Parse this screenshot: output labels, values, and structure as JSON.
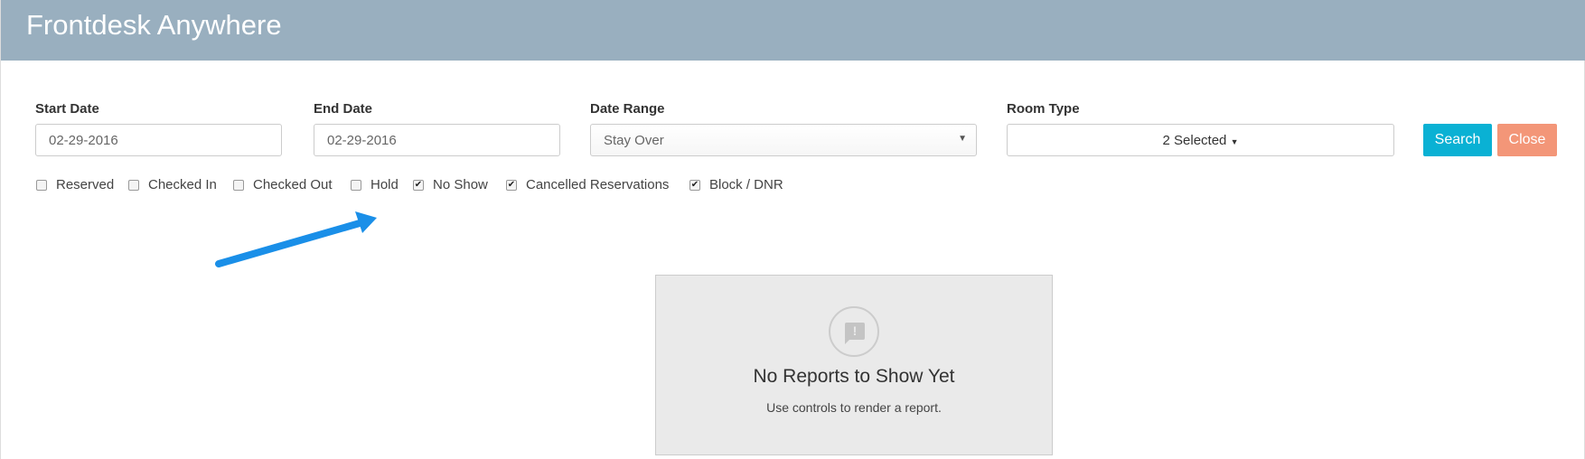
{
  "app": {
    "title": "Frontdesk Anywhere"
  },
  "filters": {
    "start_date": {
      "label": "Start Date",
      "value": "02-29-2016"
    },
    "end_date": {
      "label": "End Date",
      "value": "02-29-2016"
    },
    "date_range": {
      "label": "Date Range",
      "value": "Stay Over"
    },
    "room_type": {
      "label": "Room Type",
      "value": "2 Selected"
    }
  },
  "buttons": {
    "search": "Search",
    "close": "Close"
  },
  "statuses": [
    {
      "label": "Reserved",
      "checked": false
    },
    {
      "label": "Checked In",
      "checked": false
    },
    {
      "label": "Checked Out",
      "checked": false
    },
    {
      "label": "Hold",
      "checked": false
    },
    {
      "label": "No Show",
      "checked": true
    },
    {
      "label": "Cancelled Reservations",
      "checked": true
    },
    {
      "label": "Block / DNR",
      "checked": true
    }
  ],
  "empty_state": {
    "title": "No Reports to Show Yet",
    "subtitle": "Use controls to render a report."
  },
  "colors": {
    "header": "#99afbf",
    "search": "#0ab1d4",
    "close": "#f39678",
    "arrow": "#1a8fe8"
  }
}
